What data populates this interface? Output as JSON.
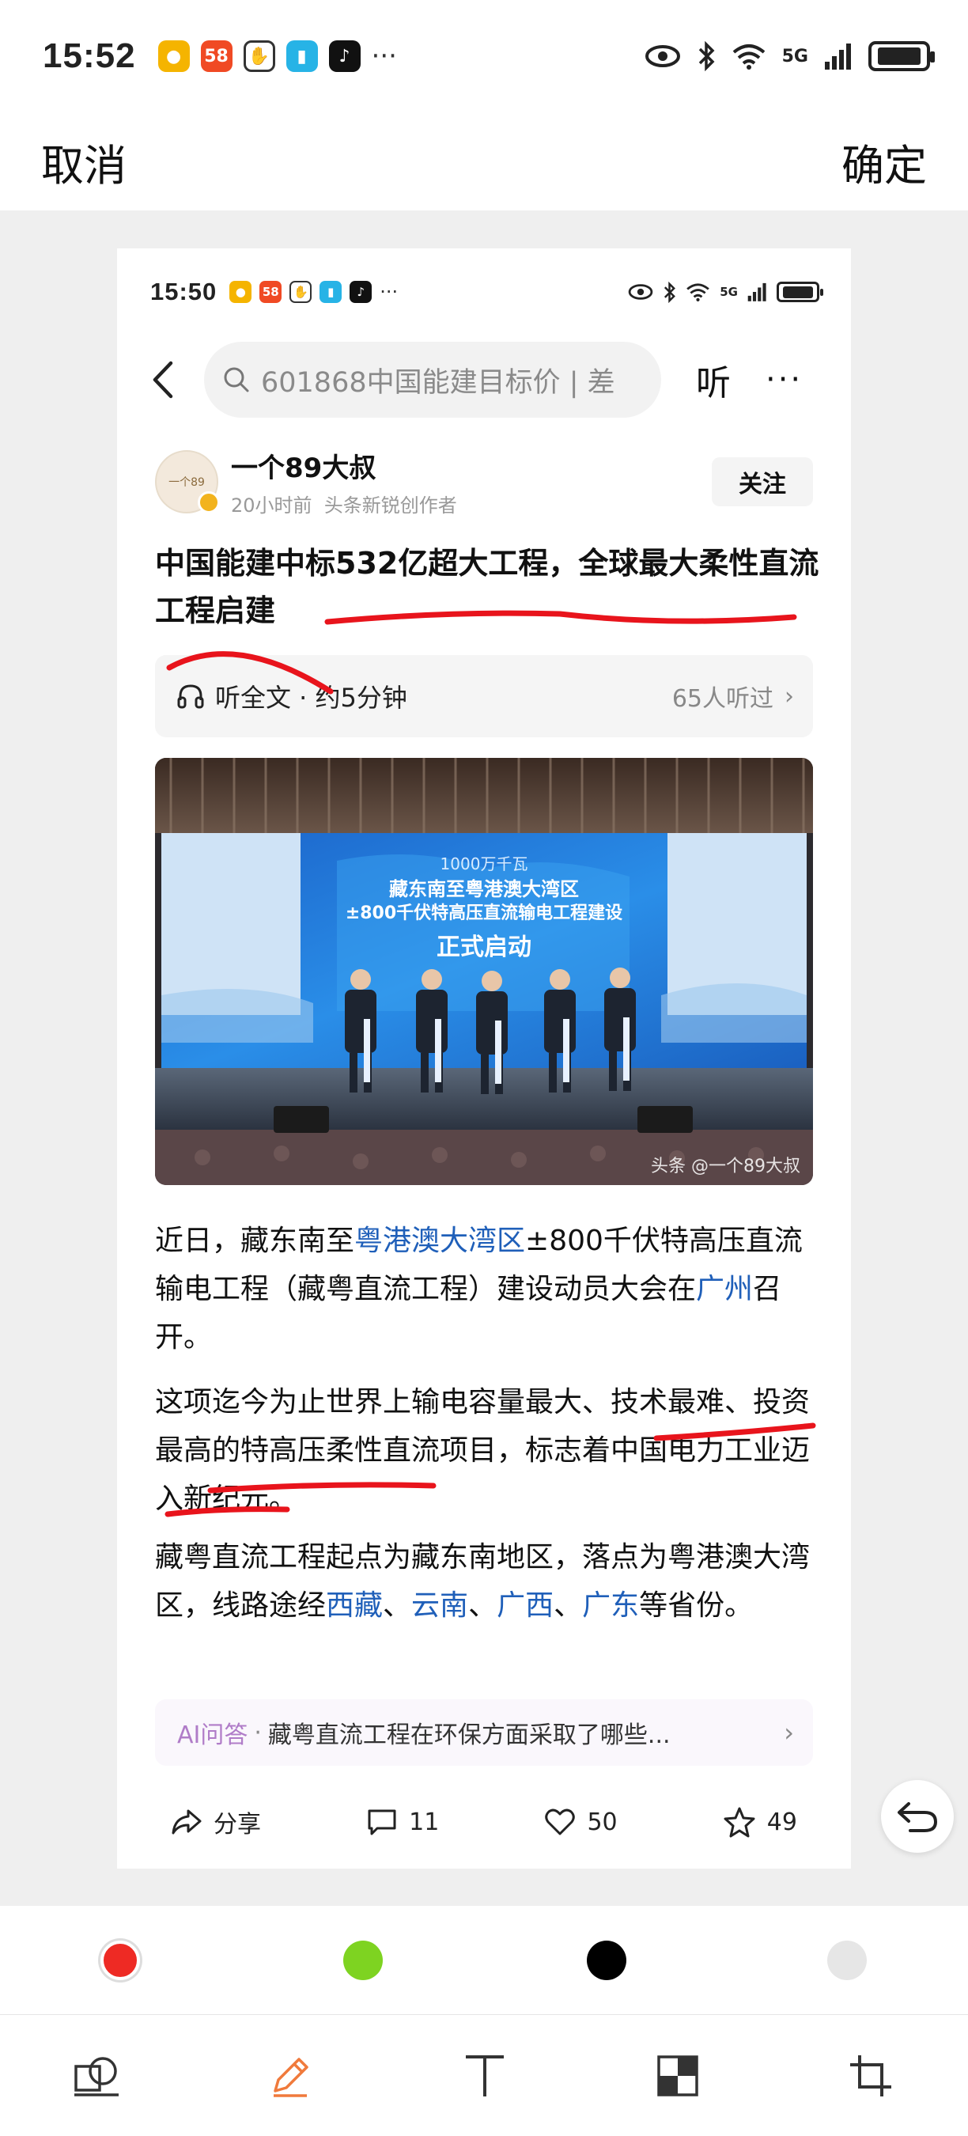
{
  "status_bar": {
    "time": "15:52",
    "network": "5G"
  },
  "header": {
    "cancel": "取消",
    "confirm": "确定"
  },
  "screenshot": {
    "status_bar": {
      "time": "15:50",
      "network": "5G"
    },
    "nav": {
      "search_text": "601868中国能建目标价 | 差",
      "listen": "听",
      "more": "···"
    },
    "author": {
      "name": "一个89大叔",
      "time": "20小时前",
      "role": "头条新锐创作者",
      "follow": "关注"
    },
    "headline": "中国能建中标532亿超大工程，全球最大柔性直流工程启建",
    "listen_bar": {
      "label": "听全文 · 约5分钟",
      "count": "65人听过"
    },
    "photo": {
      "screen_line1": "1000万千瓦",
      "screen_line2": "藏东南至粤港澳大湾区",
      "screen_line3": "±800千伏特高压直流输电工程建设",
      "screen_line4": "正式启动",
      "credit": "头条 @一个89大叔"
    },
    "paragraph1": {
      "t1": "近日，藏东南至",
      "link1": "粤港澳大湾区",
      "t2": "±800千伏特高压直流输电工程（藏粤直流工程）建设动员大会在",
      "link2": "广州",
      "t3": "召开。"
    },
    "paragraph2": "这项迄今为止世界上输电容量最大、技术最难、投资最高的特高压柔性直流项目，标志着中国电力工业迈入新纪元。",
    "paragraph3": {
      "t1": "藏粤直流工程起点为藏东南地区，落点为粤港澳大湾区，线路途经",
      "link1": "西藏",
      "sep1": "、",
      "link2": "云南",
      "sep2": "、",
      "link3": "广西",
      "sep3": "、",
      "link4": "广东",
      "t2": "等省份。"
    },
    "ai_bar": {
      "label": "AI问答",
      "question": "藏粤直流工程在环保方面采取了哪些..."
    },
    "actions": {
      "share": "分享",
      "comments": "11",
      "likes": "50",
      "favorites": "49"
    }
  },
  "palette": {
    "colors": [
      "#ee2a24",
      "#7ed321",
      "#000000",
      "#e6e6e6"
    ],
    "selected": "#ee2a24"
  },
  "annotation_color": "#e8141c",
  "link_color": "#1f5fb9"
}
